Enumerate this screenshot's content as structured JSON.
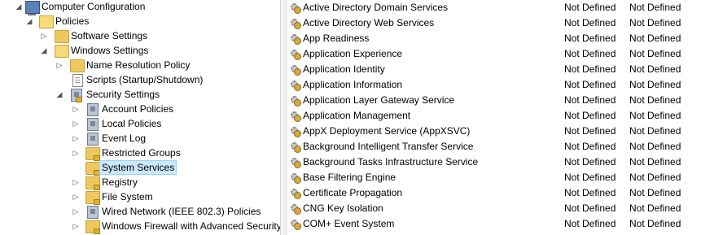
{
  "tree": {
    "nodes": [
      {
        "label": "Computer Configuration",
        "icon": "computer-icon"
      },
      {
        "label": "Policies",
        "icon": "folder-icon"
      },
      {
        "label": "Software Settings",
        "icon": "folder-icon"
      },
      {
        "label": "Windows Settings",
        "icon": "folder-icon"
      },
      {
        "label": "Name Resolution Policy",
        "icon": "folder-icon"
      },
      {
        "label": "Scripts (Startup/Shutdown)",
        "icon": "script-icon"
      },
      {
        "label": "Security Settings",
        "icon": "security-icon"
      },
      {
        "label": "Account Policies",
        "icon": "policy-icon"
      },
      {
        "label": "Local Policies",
        "icon": "policy-icon"
      },
      {
        "label": "Event Log",
        "icon": "policy-icon"
      },
      {
        "label": "Restricted Groups",
        "icon": "locked-folder-icon"
      },
      {
        "label": "System Services",
        "icon": "locked-folder-icon"
      },
      {
        "label": "Registry",
        "icon": "locked-folder-icon"
      },
      {
        "label": "File System",
        "icon": "locked-folder-icon"
      },
      {
        "label": "Wired Network (IEEE 802.3) Policies",
        "icon": "policy-icon"
      },
      {
        "label": "Windows Firewall with Advanced Security",
        "icon": "locked-folder-icon"
      }
    ],
    "selected": "System Services"
  },
  "services": [
    {
      "name": "Active Directory Domain Services",
      "startup": "Not Defined",
      "permission": "Not Defined"
    },
    {
      "name": "Active Directory Web Services",
      "startup": "Not Defined",
      "permission": "Not Defined"
    },
    {
      "name": "App Readiness",
      "startup": "Not Defined",
      "permission": "Not Defined"
    },
    {
      "name": "Application Experience",
      "startup": "Not Defined",
      "permission": "Not Defined"
    },
    {
      "name": "Application Identity",
      "startup": "Not Defined",
      "permission": "Not Defined"
    },
    {
      "name": "Application Information",
      "startup": "Not Defined",
      "permission": "Not Defined"
    },
    {
      "name": "Application Layer Gateway Service",
      "startup": "Not Defined",
      "permission": "Not Defined"
    },
    {
      "name": "Application Management",
      "startup": "Not Defined",
      "permission": "Not Defined"
    },
    {
      "name": "AppX Deployment Service (AppXSVC)",
      "startup": "Not Defined",
      "permission": "Not Defined"
    },
    {
      "name": "Background Intelligent Transfer Service",
      "startup": "Not Defined",
      "permission": "Not Defined"
    },
    {
      "name": "Background Tasks Infrastructure Service",
      "startup": "Not Defined",
      "permission": "Not Defined"
    },
    {
      "name": "Base Filtering Engine",
      "startup": "Not Defined",
      "permission": "Not Defined"
    },
    {
      "name": "Certificate Propagation",
      "startup": "Not Defined",
      "permission": "Not Defined"
    },
    {
      "name": "CNG Key Isolation",
      "startup": "Not Defined",
      "permission": "Not Defined"
    },
    {
      "name": "COM+ Event System",
      "startup": "Not Defined",
      "permission": "Not Defined"
    }
  ]
}
